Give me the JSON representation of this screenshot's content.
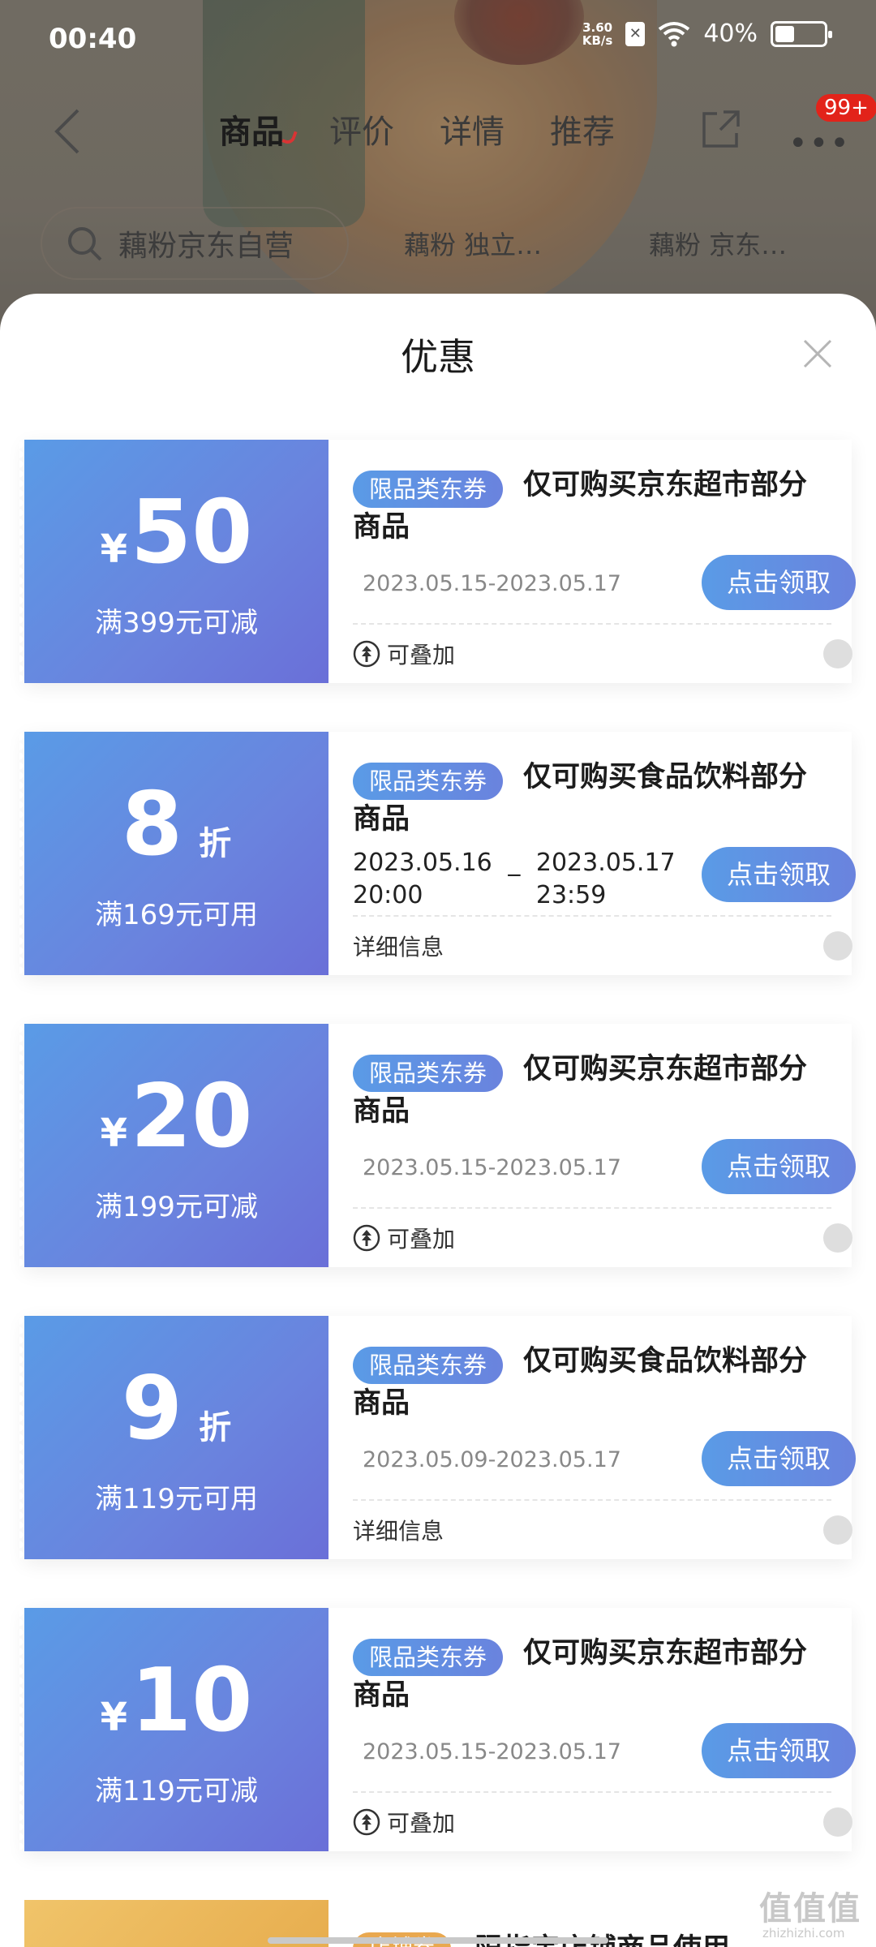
{
  "status_bar": {
    "time": "00:40",
    "net_speed_value": "3.60",
    "net_speed_unit": "KB/s",
    "battery": "40%",
    "battery_level": 0.4
  },
  "nav": {
    "tabs": [
      "商品",
      "评价",
      "详情",
      "推荐"
    ],
    "active_tab": 0,
    "badge": "99+"
  },
  "search": {
    "text": "藕粉京东自营",
    "chips": [
      "藕粉 独立…",
      "藕粉 京东…"
    ]
  },
  "sheet": {
    "title": "优惠",
    "coupons": [
      {
        "currency": "¥",
        "amount": "50",
        "unit": "",
        "condition": "满399元可减",
        "tag": "限品类东券",
        "title": "仅可购买京东超市部分商品",
        "date": "2023.05.15-2023.05.17",
        "button": "点击领取",
        "footer": "可叠加",
        "stackable": true
      },
      {
        "currency": "",
        "amount": "8",
        "unit": "折",
        "condition": "满169元可用",
        "tag": "限品类东券",
        "title": "仅可购买食品饮料部分商品",
        "date_start": "2023.05.16\n20:00",
        "date_sep": "_",
        "date_end": "2023.05.17\n23:59",
        "button": "点击领取",
        "footer": "详细信息",
        "stackable": false
      },
      {
        "currency": "¥",
        "amount": "20",
        "unit": "",
        "condition": "满199元可减",
        "tag": "限品类东券",
        "title": "仅可购买京东超市部分商品",
        "date": "2023.05.15-2023.05.17",
        "button": "点击领取",
        "footer": "可叠加",
        "stackable": true
      },
      {
        "currency": "",
        "amount": "9",
        "unit": "折",
        "condition": "满119元可用",
        "tag": "限品类东券",
        "title": "仅可购买食品饮料部分商品",
        "date": "2023.05.09-2023.05.17",
        "button": "点击领取",
        "footer": "详细信息",
        "stackable": false
      },
      {
        "currency": "¥",
        "amount": "10",
        "unit": "",
        "condition": "满119元可减",
        "tag": "限品类东券",
        "title": "仅可购买京东超市部分商品",
        "date": "2023.05.15-2023.05.17",
        "button": "点击领取",
        "footer": "可叠加",
        "stackable": true
      }
    ],
    "partial_coupon": {
      "tag": "店铺券",
      "title": "限指定店铺商品使用",
      "hidden_below_fold": true
    }
  },
  "watermark": {
    "text": "值值值",
    "sub": "zhizhizhi.com"
  },
  "icons": [
    "back-icon",
    "share-icon",
    "more-icon",
    "search-icon",
    "close-icon",
    "stack-icon",
    "chevron-down-icon"
  ]
}
